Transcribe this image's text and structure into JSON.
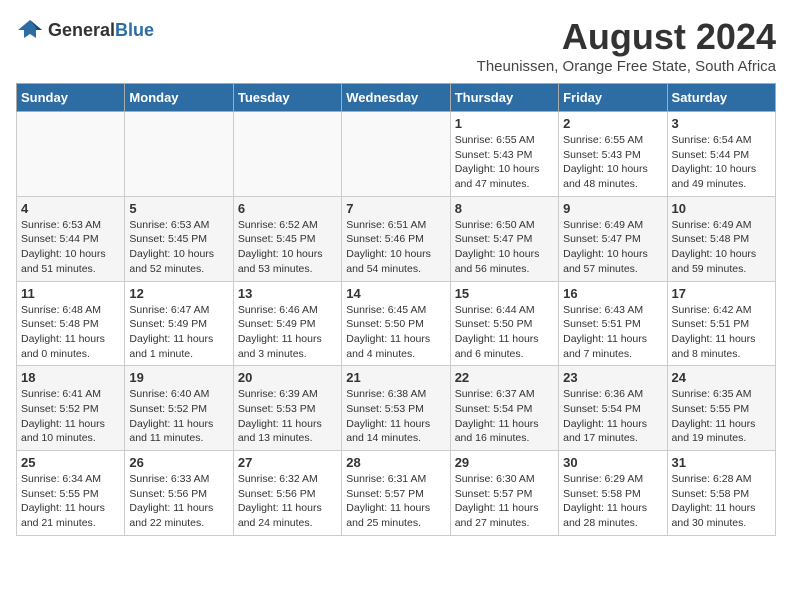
{
  "logo": {
    "general": "General",
    "blue": "Blue"
  },
  "title": "August 2024",
  "subtitle": "Theunissen, Orange Free State, South Africa",
  "days_of_week": [
    "Sunday",
    "Monday",
    "Tuesday",
    "Wednesday",
    "Thursday",
    "Friday",
    "Saturday"
  ],
  "weeks": [
    [
      {
        "day": "",
        "info": ""
      },
      {
        "day": "",
        "info": ""
      },
      {
        "day": "",
        "info": ""
      },
      {
        "day": "",
        "info": ""
      },
      {
        "day": "1",
        "info": "Sunrise: 6:55 AM\nSunset: 5:43 PM\nDaylight: 10 hours and 47 minutes."
      },
      {
        "day": "2",
        "info": "Sunrise: 6:55 AM\nSunset: 5:43 PM\nDaylight: 10 hours and 48 minutes."
      },
      {
        "day": "3",
        "info": "Sunrise: 6:54 AM\nSunset: 5:44 PM\nDaylight: 10 hours and 49 minutes."
      }
    ],
    [
      {
        "day": "4",
        "info": "Sunrise: 6:53 AM\nSunset: 5:44 PM\nDaylight: 10 hours and 51 minutes."
      },
      {
        "day": "5",
        "info": "Sunrise: 6:53 AM\nSunset: 5:45 PM\nDaylight: 10 hours and 52 minutes."
      },
      {
        "day": "6",
        "info": "Sunrise: 6:52 AM\nSunset: 5:45 PM\nDaylight: 10 hours and 53 minutes."
      },
      {
        "day": "7",
        "info": "Sunrise: 6:51 AM\nSunset: 5:46 PM\nDaylight: 10 hours and 54 minutes."
      },
      {
        "day": "8",
        "info": "Sunrise: 6:50 AM\nSunset: 5:47 PM\nDaylight: 10 hours and 56 minutes."
      },
      {
        "day": "9",
        "info": "Sunrise: 6:49 AM\nSunset: 5:47 PM\nDaylight: 10 hours and 57 minutes."
      },
      {
        "day": "10",
        "info": "Sunrise: 6:49 AM\nSunset: 5:48 PM\nDaylight: 10 hours and 59 minutes."
      }
    ],
    [
      {
        "day": "11",
        "info": "Sunrise: 6:48 AM\nSunset: 5:48 PM\nDaylight: 11 hours and 0 minutes."
      },
      {
        "day": "12",
        "info": "Sunrise: 6:47 AM\nSunset: 5:49 PM\nDaylight: 11 hours and 1 minute."
      },
      {
        "day": "13",
        "info": "Sunrise: 6:46 AM\nSunset: 5:49 PM\nDaylight: 11 hours and 3 minutes."
      },
      {
        "day": "14",
        "info": "Sunrise: 6:45 AM\nSunset: 5:50 PM\nDaylight: 11 hours and 4 minutes."
      },
      {
        "day": "15",
        "info": "Sunrise: 6:44 AM\nSunset: 5:50 PM\nDaylight: 11 hours and 6 minutes."
      },
      {
        "day": "16",
        "info": "Sunrise: 6:43 AM\nSunset: 5:51 PM\nDaylight: 11 hours and 7 minutes."
      },
      {
        "day": "17",
        "info": "Sunrise: 6:42 AM\nSunset: 5:51 PM\nDaylight: 11 hours and 8 minutes."
      }
    ],
    [
      {
        "day": "18",
        "info": "Sunrise: 6:41 AM\nSunset: 5:52 PM\nDaylight: 11 hours and 10 minutes."
      },
      {
        "day": "19",
        "info": "Sunrise: 6:40 AM\nSunset: 5:52 PM\nDaylight: 11 hours and 11 minutes."
      },
      {
        "day": "20",
        "info": "Sunrise: 6:39 AM\nSunset: 5:53 PM\nDaylight: 11 hours and 13 minutes."
      },
      {
        "day": "21",
        "info": "Sunrise: 6:38 AM\nSunset: 5:53 PM\nDaylight: 11 hours and 14 minutes."
      },
      {
        "day": "22",
        "info": "Sunrise: 6:37 AM\nSunset: 5:54 PM\nDaylight: 11 hours and 16 minutes."
      },
      {
        "day": "23",
        "info": "Sunrise: 6:36 AM\nSunset: 5:54 PM\nDaylight: 11 hours and 17 minutes."
      },
      {
        "day": "24",
        "info": "Sunrise: 6:35 AM\nSunset: 5:55 PM\nDaylight: 11 hours and 19 minutes."
      }
    ],
    [
      {
        "day": "25",
        "info": "Sunrise: 6:34 AM\nSunset: 5:55 PM\nDaylight: 11 hours and 21 minutes."
      },
      {
        "day": "26",
        "info": "Sunrise: 6:33 AM\nSunset: 5:56 PM\nDaylight: 11 hours and 22 minutes."
      },
      {
        "day": "27",
        "info": "Sunrise: 6:32 AM\nSunset: 5:56 PM\nDaylight: 11 hours and 24 minutes."
      },
      {
        "day": "28",
        "info": "Sunrise: 6:31 AM\nSunset: 5:57 PM\nDaylight: 11 hours and 25 minutes."
      },
      {
        "day": "29",
        "info": "Sunrise: 6:30 AM\nSunset: 5:57 PM\nDaylight: 11 hours and 27 minutes."
      },
      {
        "day": "30",
        "info": "Sunrise: 6:29 AM\nSunset: 5:58 PM\nDaylight: 11 hours and 28 minutes."
      },
      {
        "day": "31",
        "info": "Sunrise: 6:28 AM\nSunset: 5:58 PM\nDaylight: 11 hours and 30 minutes."
      }
    ]
  ]
}
